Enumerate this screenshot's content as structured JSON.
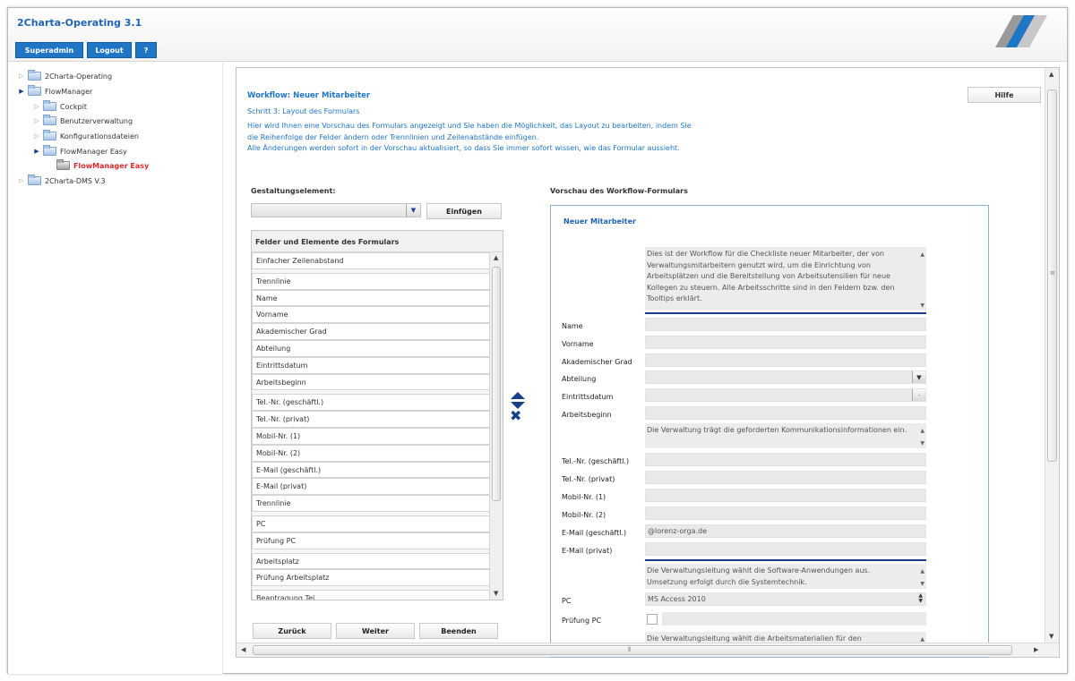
{
  "app": {
    "title": "2Charta-Operating 3.1"
  },
  "top_buttons": [
    {
      "label": "Superadmin"
    },
    {
      "label": "Logout"
    },
    {
      "label": "?"
    }
  ],
  "sidebar": {
    "items": [
      {
        "label": "2Charta-Operating"
      },
      {
        "label": "FlowManager"
      },
      {
        "label": "Cockpit"
      },
      {
        "label": "Benutzerverwaltung"
      },
      {
        "label": "Konfigurationsdateien"
      },
      {
        "label": "FlowManager Easy"
      },
      {
        "label": "FlowManager Easy"
      },
      {
        "label": "2Charta-DMS V.3"
      }
    ]
  },
  "workflow": {
    "title": "Workflow: Neuer Mitarbeiter",
    "step": "Schritt 3: Layout des Formulars",
    "desc_lines": [
      "Hier wird Ihnen eine Vorschau des Formulars angezeigt und Sie haben die Möglichkeit, das Layout zu bearbeiten, indem Sie",
      "die Reihenfolge der Felder ändern oder Trennlinien und Zeilenabstände einfügen.",
      "Alle Änderungen werden sofort in der Vorschau aktualisiert, so dass Sie immer sofort wissen, wie das Formular aussieht."
    ],
    "help_label": "Hilfe"
  },
  "designer": {
    "element_label": "Gestaltungselement:",
    "insert_label": "Einfügen",
    "fields_header": "Felder und Elemente des Formulars",
    "fields": [
      {
        "label": "Einfacher Zeilenabstand"
      },
      {
        "label": "Trennlinie"
      },
      {
        "label": "Name"
      },
      {
        "label": "Vorname"
      },
      {
        "label": "Akademischer Grad"
      },
      {
        "label": "Abteilung"
      },
      {
        "label": "Eintrittsdatum"
      },
      {
        "label": "Arbeitsbeginn"
      },
      {
        "label": "Tel.-Nr. (geschäftl.)"
      },
      {
        "label": "Tel.-Nr. (privat)"
      },
      {
        "label": "Mobil-Nr. (1)"
      },
      {
        "label": "Mobil-Nr. (2)"
      },
      {
        "label": "E-Mail (geschäftl.)"
      },
      {
        "label": "E-Mail (privat)"
      },
      {
        "label": "Trennlinie"
      },
      {
        "label": "PC"
      },
      {
        "label": "Prüfung PC"
      },
      {
        "label": "Arbeitsplatz"
      },
      {
        "label": "Prüfung Arbeitsplatz"
      },
      {
        "label": "Beantragung Tel."
      }
    ],
    "back_label": "Zurück",
    "next_label": "Weiter",
    "finish_label": "Beenden"
  },
  "preview": {
    "heading": "Vorschau des Workflow-Formulars",
    "form_title": "Neuer Mitarbeiter",
    "note1": "Dies ist der Workflow für die Checkliste neuer Mitarbeiter, der von Verwaltungsmitarbeitern genutzt wird, um die Einrichtung von Arbeitsplätzen und die Bereitstellung von Arbeitsutensilien für neue Kollegen zu steuern. Alle Arbeitsschritte sind in den Feldern bzw. den Tooltips erklärt.",
    "fields_a": [
      {
        "label": "Name",
        "value": ""
      },
      {
        "label": "Vorname",
        "value": ""
      },
      {
        "label": "Akademischer Grad",
        "value": ""
      },
      {
        "label": "Abteilung",
        "value": ""
      },
      {
        "label": "Eintrittsdatum",
        "value": ""
      },
      {
        "label": "Arbeitsbeginn",
        "value": ""
      }
    ],
    "note2": "Die Verwaltung trägt die geforderten Kommunikationsinformationen ein.",
    "fields_b": [
      {
        "label": "Tel.-Nr. (geschäftl.)",
        "value": ""
      },
      {
        "label": "Tel.-Nr. (privat)",
        "value": ""
      },
      {
        "label": "Mobil-Nr. (1)",
        "value": ""
      },
      {
        "label": "Mobil-Nr. (2)",
        "value": ""
      },
      {
        "label": "E-Mail (geschäftl.)",
        "value": "@lorenz-orga.de"
      },
      {
        "label": "E-Mail (privat)",
        "value": ""
      }
    ],
    "note3": "Die Verwaltungsleitung wählt die Software-Anwendungen aus. Umsetzung erfolgt durch die Systemtechnik.",
    "pc_label": "PC",
    "pc_value": "MS Access 2010",
    "check_label": "Prüfung PC",
    "note4": "Die Verwaltungsleitung wählt die Arbeitsmaterialien für den"
  },
  "colors": {
    "accent": "#1f75c6",
    "icon_blue": "#1a3f8a",
    "active": "#d62b2b"
  }
}
